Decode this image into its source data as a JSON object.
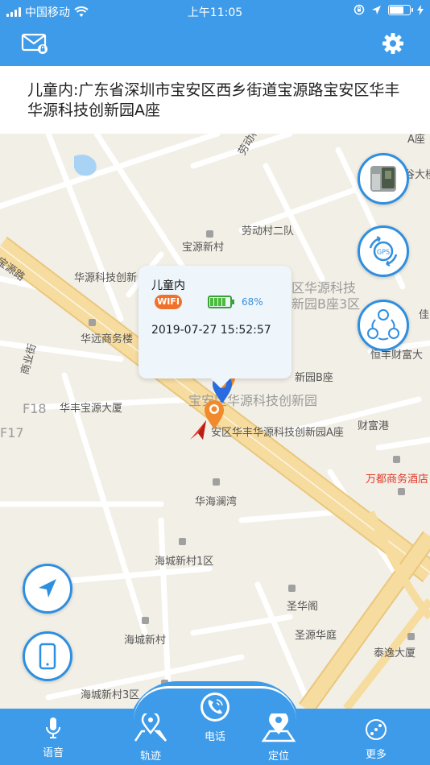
{
  "status_bar": {
    "carrier": "中国移动",
    "time": "上午11:05"
  },
  "header": {
    "mail_icon": "mail-lock-icon",
    "settings_icon": "gear-icon"
  },
  "address": {
    "text": "儿童内:广东省深圳市宝安区西乡街道宝源路宝安区华丰华源科技创新园A座"
  },
  "map": {
    "labels": [
      "宝源新村",
      "劳动村二队",
      "劳动村二队二巷",
      "华源科技创新",
      "区华源科技",
      "新园B座3区",
      "华远商务楼",
      "商业街",
      "华丰宝源大厦",
      "宝安区华源科技创新园",
      "新园B座",
      "安区华丰华源科技创新园A座",
      "财富港",
      "万都商务酒店",
      "华海澜湾",
      "海城新村1区",
      "圣华阁",
      "圣源华庭",
      "海城新村",
      "泰逸大厦",
      "海城新村3区",
      "恒丰财富大",
      "宝源路",
      "F18",
      "F17",
      "佳",
      "A座",
      "谷大楼"
    ]
  },
  "popup": {
    "name": "儿童内",
    "network": "WIFI",
    "battery": "68%",
    "battery_level": 0.68,
    "timestamp": "2019-07-27 15:52:57"
  },
  "side_buttons": {
    "gps_label": "GPS"
  },
  "nav": {
    "voice": "语音",
    "track": "轨迹",
    "call": "电话",
    "locate": "定位",
    "more": "更多"
  },
  "colors": {
    "primary": "#3d9be9",
    "wifi_badge": "#f0722a",
    "battery_green": "#4cbb3a",
    "map_bg": "#f2efe6",
    "road_main": "#f7dca0"
  }
}
